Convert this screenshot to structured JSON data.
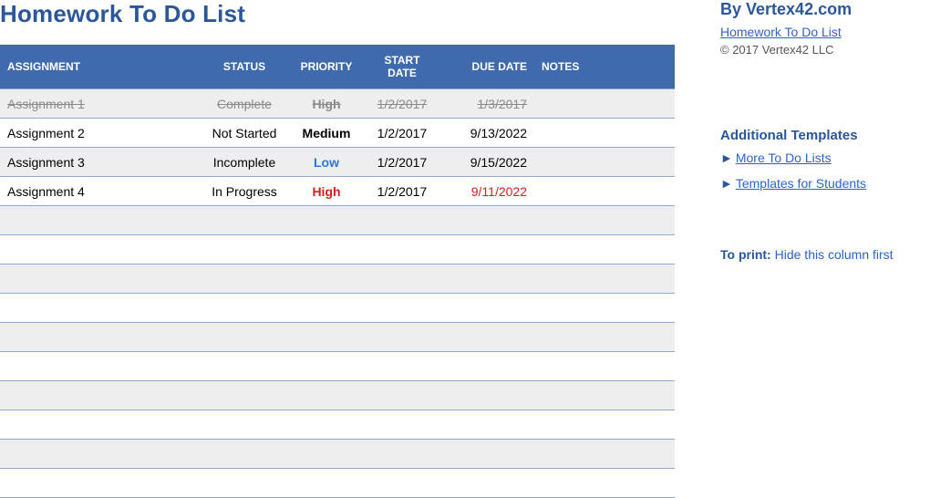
{
  "title": "Homework To Do List",
  "columns": {
    "assignment": "ASSIGNMENT",
    "status": "STATUS",
    "priority": "PRIORITY",
    "start": "START DATE",
    "due": "DUE DATE",
    "notes": "NOTES"
  },
  "rows": [
    {
      "assignment": "Assignment 1",
      "status": "Complete",
      "priority": "High",
      "start": "1/2/2017",
      "due": "1/3/2017",
      "notes": "",
      "completed": true
    },
    {
      "assignment": "Assignment 2",
      "status": "Not Started",
      "priority": "Medium",
      "start": "1/2/2017",
      "due": "9/13/2022",
      "notes": ""
    },
    {
      "assignment": "Assignment 3",
      "status": "Incomplete",
      "priority": "Low",
      "start": "1/2/2017",
      "due": "9/15/2022",
      "notes": "",
      "priority_color": "blue"
    },
    {
      "assignment": "Assignment 4",
      "status": "In Progress",
      "priority": "High",
      "start": "1/2/2017",
      "due": "9/11/2022",
      "notes": "",
      "priority_color": "red",
      "due_color": "red"
    }
  ],
  "empty_row_count": 10,
  "sidebar": {
    "byline": "By Vertex42.com",
    "main_link": "Homework To Do List",
    "copyright": "© 2017 Vertex42 LLC",
    "section_title": "Additional Templates",
    "links": [
      "More To Do Lists",
      "Templates for Students"
    ],
    "print_label": "To print:",
    "print_text": "Hide this column first"
  }
}
